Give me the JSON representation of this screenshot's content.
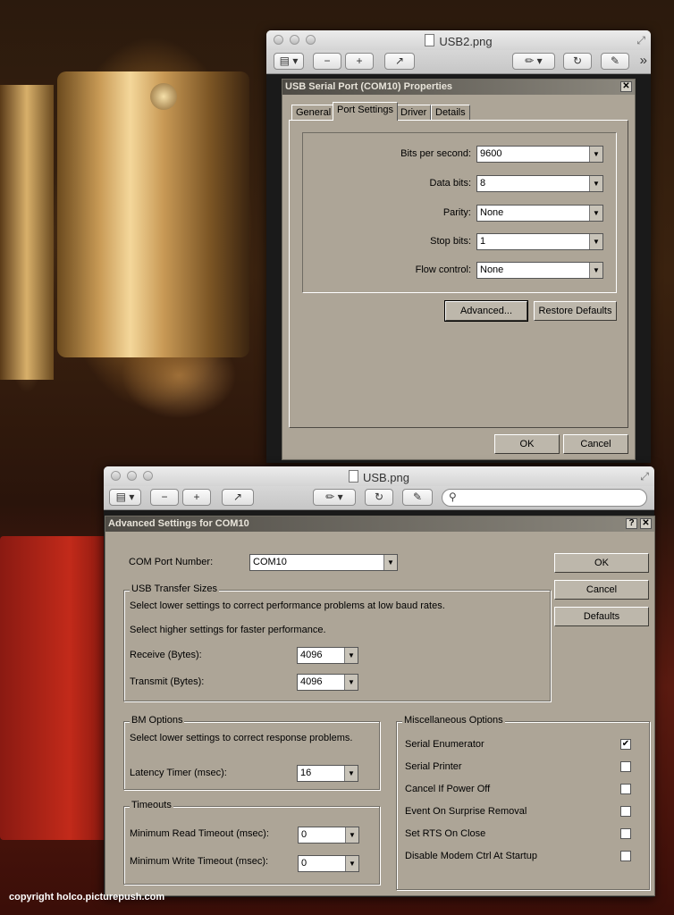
{
  "window_top": {
    "title": "USB2.png",
    "toolbar": {
      "zoom_out": "−",
      "zoom_in": "+",
      "share": "↗",
      "rotate": "↻",
      "edit": "✎",
      "more": "»"
    }
  },
  "dialog_top": {
    "title": "USB Serial Port (COM10) Properties",
    "tabs": [
      "General",
      "Port Settings",
      "Driver",
      "Details"
    ],
    "fields": [
      {
        "label": "Bits per second:",
        "value": "9600"
      },
      {
        "label": "Data bits:",
        "value": "8"
      },
      {
        "label": "Parity:",
        "value": "None"
      },
      {
        "label": "Stop bits:",
        "value": "1"
      },
      {
        "label": "Flow control:",
        "value": "None"
      }
    ],
    "advanced_label": "Advanced...",
    "restore_label": "Restore Defaults",
    "ok_label": "OK",
    "cancel_label": "Cancel"
  },
  "window_bottom": {
    "title": "USB.png"
  },
  "dialog_bottom": {
    "title": "Advanced Settings for COM10",
    "com_port_label": "COM Port Number:",
    "com_port_value": "COM10",
    "ok_label": "OK",
    "cancel_label": "Cancel",
    "defaults_label": "Defaults",
    "usb_group": {
      "title": "USB Transfer Sizes",
      "line1": "Select lower settings to correct performance problems at low baud rates.",
      "line2": "Select higher settings for faster performance.",
      "receive_label": "Receive (Bytes):",
      "receive_value": "4096",
      "transmit_label": "Transmit (Bytes):",
      "transmit_value": "4096"
    },
    "bm_group": {
      "title": "BM Options",
      "line1": "Select lower settings to correct response problems.",
      "latency_label": "Latency Timer (msec):",
      "latency_value": "16"
    },
    "timeouts_group": {
      "title": "Timeouts",
      "read_label": "Minimum Read Timeout (msec):",
      "read_value": "0",
      "write_label": "Minimum Write Timeout (msec):",
      "write_value": "0"
    },
    "misc_group": {
      "title": "Miscellaneous Options",
      "options": [
        {
          "label": "Serial Enumerator",
          "checked": true
        },
        {
          "label": "Serial Printer",
          "checked": false
        },
        {
          "label": "Cancel If Power Off",
          "checked": false
        },
        {
          "label": "Event On Surprise Removal",
          "checked": false
        },
        {
          "label": "Set RTS On Close",
          "checked": false
        },
        {
          "label": "Disable Modem Ctrl At Startup",
          "checked": false
        }
      ]
    }
  },
  "copyright": "copyright holco.picturepush.com"
}
